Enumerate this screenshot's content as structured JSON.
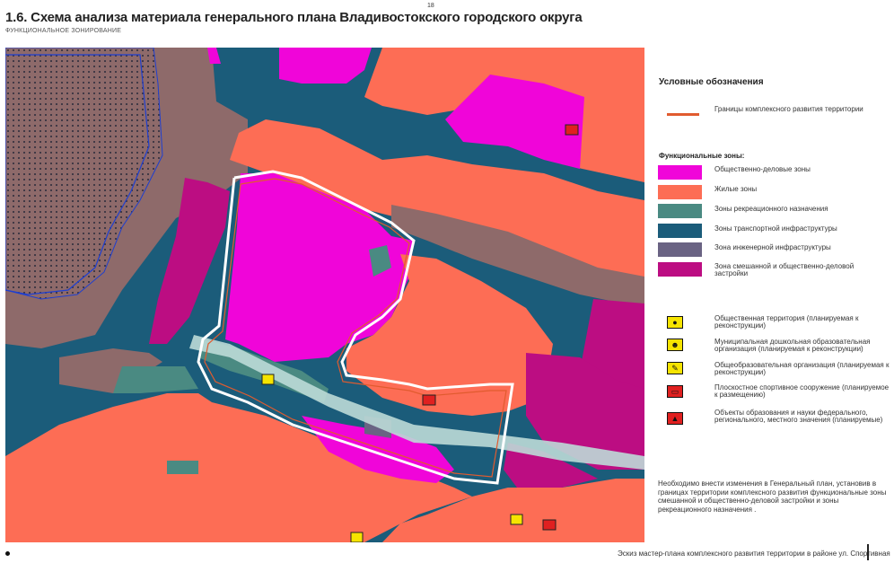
{
  "page_number": "18",
  "title": "1.6. Схема анализа материала генерального плана Владивостокского городского округа",
  "subtitle": "ФУНКЦИОНАЛЬНОЕ ЗОНИРОВАНИЕ",
  "colors": {
    "public_business": "#f005d9",
    "residential": "#fd6d55",
    "recreation": "#4a8a82",
    "transport": "#1b5c7a",
    "engineering": "#6a6383",
    "mixed": "#bc0d82",
    "brown": "#8e6a6a",
    "boundary": "#e15b2f"
  },
  "legend": {
    "title": "Условные обозначения",
    "boundary_label": "Границы комплексного развития территории",
    "zones_title": "Функциональные зоны:",
    "zones": [
      {
        "label": "Общественно-деловые зоны",
        "color": "#f005d9"
      },
      {
        "label": "Жилые зоны",
        "color": "#fd6d55"
      },
      {
        "label": "Зоны рекреационного назначения",
        "color": "#4a8a82"
      },
      {
        "label": "Зоны транспортной инфраструктуры",
        "color": "#1b5c7a"
      },
      {
        "label": "Зона инженерной инфраструктуры",
        "color": "#6a6383"
      },
      {
        "label": "Зона смешанной и общественно-деловой застройки",
        "color": "#bc0d82"
      }
    ],
    "objects": [
      {
        "label": "Общественная территория (планируемая к реконструкции)",
        "icon": "person-walking-icon",
        "glyph": "🚶",
        "bg": "#f6e400"
      },
      {
        "label": "Муниципальная дошкольная образовательная организация (планируемая к реконструкции)",
        "icon": "kindergarten-icon",
        "glyph": "☻",
        "bg": "#f6e400"
      },
      {
        "label": "Общеобразовательная организация (планируемая к реконструкции)",
        "icon": "school-icon",
        "glyph": "✎",
        "bg": "#f6e400"
      },
      {
        "label": "Плоскостное спортивное сооружение (планируемое к размещению)",
        "icon": "sport-field-icon",
        "glyph": "▭",
        "bg": "#e02020"
      },
      {
        "label": "Объекты образования и науки федерального, регионального, местного значения (планируемые)",
        "icon": "education-cap-icon",
        "glyph": "🎓",
        "bg": "#e02020"
      }
    ]
  },
  "note": "Необходимо внести изменения в Генеральный план, установив  в границах территории комплексного развития функциональные зоны смешанной и общественно-деловой застройки и зоны рекреационного назначения .",
  "footer": "Эскиз мастер-плана комплексного развития территории  в районе ул. Спортивная"
}
